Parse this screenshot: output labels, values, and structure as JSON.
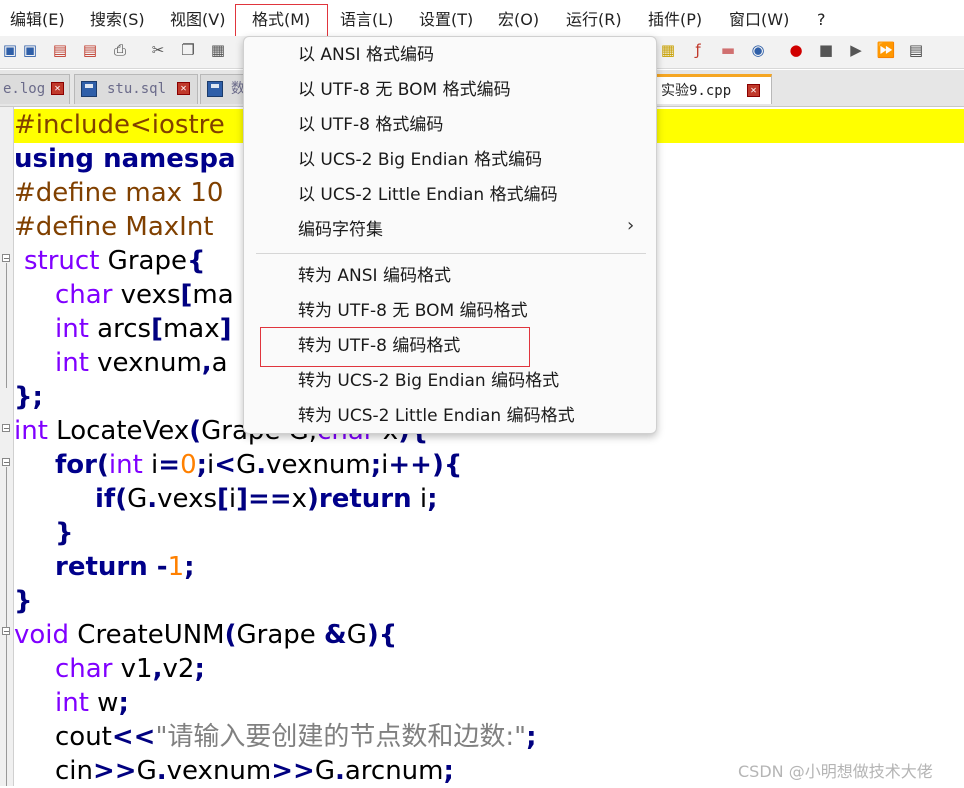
{
  "menubar": {
    "items": [
      "编辑(E)",
      "搜索(S)",
      "视图(V)",
      "格式(M)",
      "语言(L)",
      "设置(T)",
      "宏(O)",
      "运行(R)",
      "插件(P)",
      "窗口(W)",
      "?"
    ]
  },
  "tabs": [
    {
      "label": "e.log"
    },
    {
      "label": "stu.sql"
    },
    {
      "label": "数"
    },
    {
      "label": "实验9.cpp"
    }
  ],
  "dropdown": {
    "items": [
      "以 ANSI 格式编码",
      "以 UTF-8 无 BOM 格式编码",
      "以 UTF-8 格式编码",
      "以 UCS-2 Big Endian 格式编码",
      "以 UCS-2 Little Endian 格式编码",
      "编码字符集",
      "转为 ANSI 编码格式",
      "转为 UTF-8 无 BOM 编码格式",
      "转为 UTF-8 编码格式",
      "转为 UCS-2 Big Endian 编码格式",
      "转为 UCS-2 Little Endian 编码格式"
    ],
    "submenu_chevron": "›"
  },
  "code": {
    "l1_pp": "#include<iostre",
    "l2_kw": "using namespa",
    "l3_pp": "#define max 10",
    "l4_pp": "#define MaxInt",
    "l5_ty": "struct",
    "l5_name": " Grape",
    "l5_op": "{",
    "l6_ty": "char",
    "l6_rest": " vexs",
    "l6_op": "[",
    "l6_tail": "ma",
    "l7_ty": "int",
    "l7_rest": " arcs",
    "l7_op": "[",
    "l7_tail": "max",
    "l7_op2": "]",
    "l8_ty": "int",
    "l8_rest": " vexnum",
    "l8_op": ",",
    "l8_tail": "a",
    "l9_op": "};",
    "l10_ty": "int",
    "l10_rest": " LocateVex",
    "l10_op": "(",
    "l10_tail": "Grape G,",
    "l10_ty2": "char",
    "l10_tail2": " x",
    "l10_op2": "){",
    "l11_kw": "for",
    "l11_op": "(",
    "l11_ty": "int",
    "l11_a": " i",
    "l11_op2": "=",
    "l11_num": "0",
    "l11_op3": ";",
    "l11_b": "i",
    "l11_op4": "<",
    "l11_c": "G",
    "l11_op5": ".",
    "l11_d": "vexnum",
    "l11_op6": ";",
    "l11_e": "i",
    "l11_op7": "++){",
    "l12_kw": "if",
    "l12_op": "(",
    "l12_a": "G",
    "l12_op2": ".",
    "l12_b": "vexs",
    "l12_op3": "[",
    "l12_c": "i",
    "l12_op4": "]==",
    "l12_d": "x",
    "l12_op5": ")",
    "l12_kw2": "return",
    "l12_e": " i",
    "l12_op6": ";",
    "l13_op": "}",
    "l14_kw": "return",
    "l14_op": " -",
    "l14_num": "1",
    "l14_op2": ";",
    "l15_op": "}",
    "l16_ty": "void",
    "l16_rest": " CreateUNM",
    "l16_op": "(",
    "l16_a": "Grape ",
    "l16_op2": "&",
    "l16_b": "G",
    "l16_op3": "){",
    "l17_ty": "char",
    "l17_rest": " v1",
    "l17_op": ",",
    "l17_b": "v2",
    "l17_op2": ";",
    "l18_ty": "int",
    "l18_rest": " w",
    "l18_op": ";",
    "l19_a": "cout",
    "l19_op": "<<",
    "l19_str": "\"请输入要创建的节点数和边数:\"",
    "l19_op2": ";",
    "l20_a": "cin",
    "l20_op": ">>",
    "l20_b": "G",
    "l20_op2": ".",
    "l20_c": "vexnum",
    "l20_op3": ">>",
    "l20_d": "G",
    "l20_op4": ".",
    "l20_e": "arcnum",
    "l20_op5": ";"
  },
  "watermark": "CSDN @小明想做技术大佬"
}
